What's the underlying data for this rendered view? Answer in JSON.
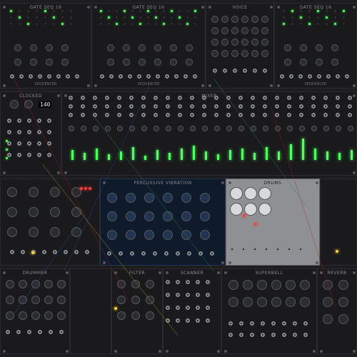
{
  "window": {
    "title": ""
  },
  "modules": [
    {
      "id": "gate-seq-1",
      "title": "GATE SEQ 16",
      "sub": "SEQUENCER",
      "theme": "dark"
    },
    {
      "id": "gate-seq-2",
      "title": "GATE SEQ 16",
      "sub": "SEQUENCER",
      "theme": "dark"
    },
    {
      "id": "voice-module",
      "title": "VOICE",
      "sub": "",
      "theme": "dark"
    },
    {
      "id": "gate-seq-3",
      "title": "GATE SEQ 16",
      "sub": "SEQUENCER",
      "theme": "dark"
    },
    {
      "id": "clocked",
      "title": "CLOCKED",
      "sub": "",
      "theme": "dark"
    },
    {
      "id": "mixer",
      "title": "MIXER",
      "sub": "",
      "theme": "dark"
    },
    {
      "id": "percussive",
      "title": "PERCUSSIVE VIBRATION",
      "sub": "",
      "theme": "blue"
    },
    {
      "id": "drums",
      "title": "DRUMS",
      "sub": "",
      "theme": "light"
    },
    {
      "id": "bottom-1",
      "title": "DRUMMER",
      "sub": "",
      "theme": "dark"
    },
    {
      "id": "bottom-2",
      "title": "FILTER",
      "sub": "",
      "theme": "dark"
    },
    {
      "id": "bottom-3",
      "title": "SCANNER",
      "sub": "",
      "theme": "dark"
    },
    {
      "id": "bottom-4",
      "title": "SUPERBELL",
      "sub": "",
      "theme": "dark"
    },
    {
      "id": "bottom-5",
      "title": "REVERB",
      "sub": "",
      "theme": "dark"
    }
  ],
  "clock": {
    "display": "140"
  },
  "colors": {
    "led_on": "#53ff63",
    "led_red": "#ff3b3b",
    "led_yellow": "#ffd23b",
    "cable_red": "#b22222",
    "cable_green": "#2e8b57",
    "cable_blue": "#1e5aa8",
    "cable_yellow": "#b8a82a"
  },
  "icons": [
    "knob-icon",
    "jack-icon",
    "led-icon",
    "button-icon",
    "screw-icon"
  ]
}
